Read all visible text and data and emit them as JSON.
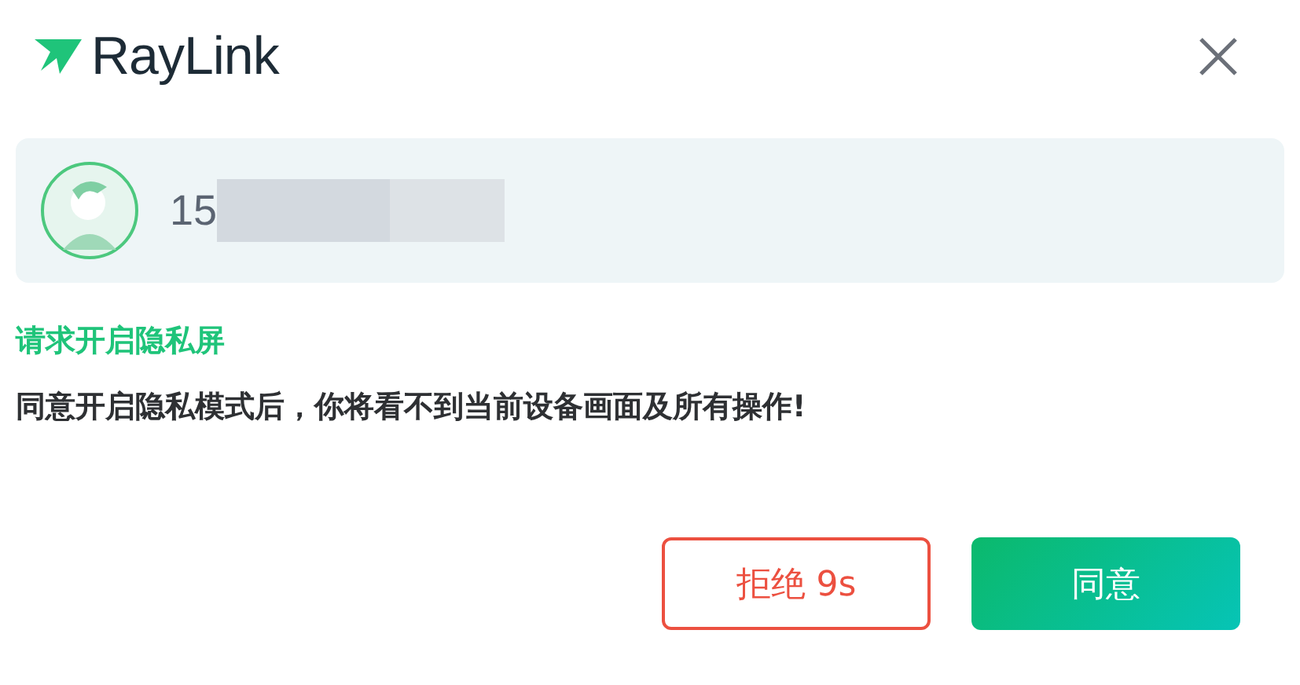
{
  "brand": "RayLink",
  "user": {
    "phone_prefix": "15"
  },
  "title": "请求开启隐私屏",
  "message": "同意开启隐私模式后，你将看不到当前设备画面及所有操作!",
  "buttons": [
    {
      "label": "拒绝 9s",
      "kind": "outline"
    },
    {
      "label": "同意",
      "kind": "primary"
    }
  ]
}
